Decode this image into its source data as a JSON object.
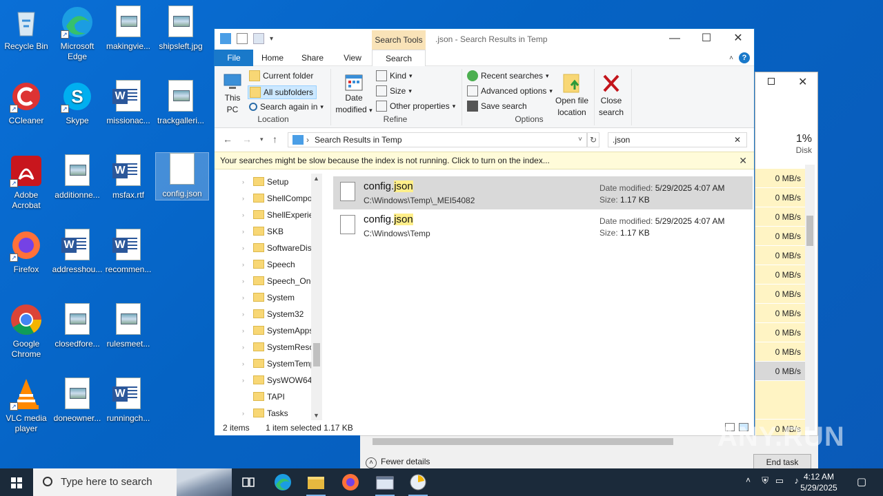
{
  "desktop": {
    "icons": [
      {
        "label": "Recycle Bin"
      },
      {
        "label": "Microsoft Edge"
      },
      {
        "label": "makingvie..."
      },
      {
        "label": "shipsleft.jpg"
      },
      {
        "label": "CCleaner"
      },
      {
        "label": "Skype"
      },
      {
        "label": "missionac..."
      },
      {
        "label": "trackgalleri..."
      },
      {
        "label": "Adobe Acrobat"
      },
      {
        "label": "additionne..."
      },
      {
        "label": "msfax.rtf"
      },
      {
        "label": "config.json"
      },
      {
        "label": "Firefox"
      },
      {
        "label": "addresshou..."
      },
      {
        "label": "recommen..."
      },
      {
        "label": "Google Chrome"
      },
      {
        "label": "closedfore..."
      },
      {
        "label": "rulesmeet..."
      },
      {
        "label": "VLC media player"
      },
      {
        "label": "doneowner..."
      },
      {
        "label": "runningch..."
      }
    ]
  },
  "taskmgr": {
    "disk_pct": "1%",
    "disk_label": "Disk",
    "rows": [
      "0 MB/s",
      "0 MB/s",
      "0 MB/s",
      "0 MB/s",
      "0 MB/s",
      "0 MB/s",
      "0 MB/s",
      "0 MB/s",
      "0 MB/s",
      "0 MB/s",
      "0 MB/s",
      "",
      "0 MB/s"
    ],
    "fewer_details": "Fewer details",
    "end_task": "End task"
  },
  "explorer": {
    "context_tab": "Search Tools",
    "title": ".json - Search Results in Temp",
    "menu": {
      "file": "File",
      "home": "Home",
      "share": "Share",
      "view": "View",
      "search": "Search"
    },
    "ribbon": {
      "this_pc_1": "This",
      "this_pc_2": "PC",
      "current_folder": "Current folder",
      "all_subfolders": "All subfolders",
      "search_again": "Search again in",
      "location": "Location",
      "date_modified_1": "Date",
      "date_modified_2": "modified",
      "kind": "Kind",
      "size": "Size",
      "other_properties": "Other properties",
      "refine": "Refine",
      "recent_searches": "Recent searches",
      "advanced_options": "Advanced options",
      "save_search": "Save search",
      "open_file_location_1": "Open file",
      "open_file_location_2": "location",
      "options": "Options",
      "close_search_1": "Close",
      "close_search_2": "search"
    },
    "address": "Search Results in Temp",
    "search_value": ".json",
    "infobar": "Your searches might be slow because the index is not running.  Click to turn on the index...",
    "tree": [
      "Setup",
      "ShellCompo",
      "ShellExperie",
      "SKB",
      "SoftwareDis",
      "Speech",
      "Speech_One",
      "System",
      "System32",
      "SystemApps",
      "SystemReso",
      "SystemTemp",
      "SysWOW64",
      "TAPI",
      "Tasks"
    ],
    "results": [
      {
        "name_pre": "config.",
        "name_hl": "json",
        "path": "C:\\Windows\\Temp\\_MEI54082",
        "date_label": "Date modified:",
        "date": "5/29/2025 4:07 AM",
        "size_label": "Size:",
        "size": "1.17 KB"
      },
      {
        "name_pre": "config.",
        "name_hl": "json",
        "path": "C:\\Windows\\Temp",
        "date_label": "Date modified:",
        "date": "5/29/2025 4:07 AM",
        "size_label": "Size:",
        "size": "1.17 KB"
      }
    ],
    "status_items": "2 items",
    "status_selected": "1 item selected  1.17 KB"
  },
  "taskbar": {
    "search_placeholder": "Type here to search",
    "time": "4:12 AM",
    "date": "5/29/2025"
  },
  "watermark": "ANY.RUN"
}
